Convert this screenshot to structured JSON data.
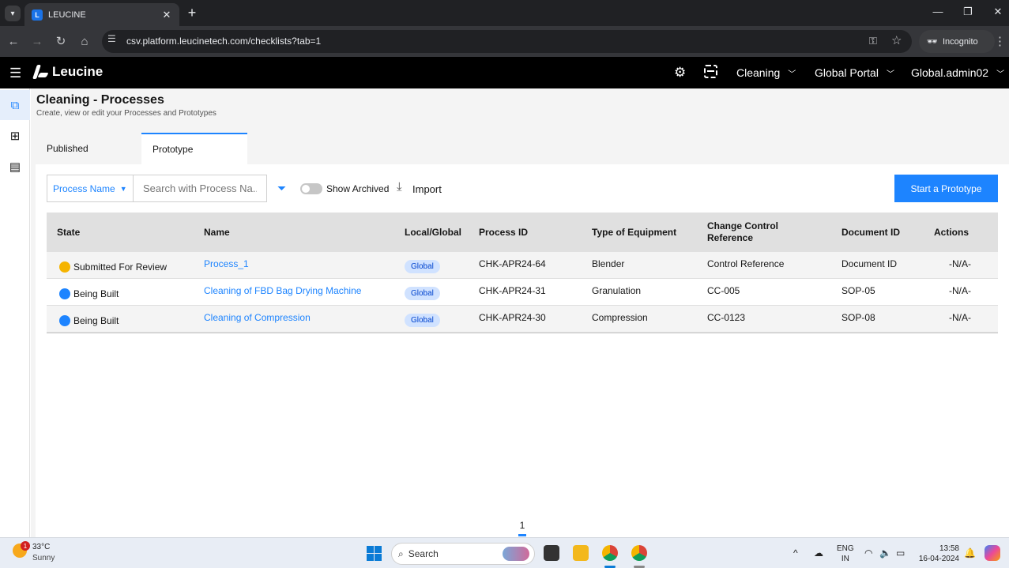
{
  "browser": {
    "tab_title": "LEUCINE",
    "url": "csv.platform.leucinetech.com/checklists?tab=1",
    "incognito_label": "Incognito"
  },
  "app": {
    "brand": "Leucine",
    "module": "Cleaning",
    "portal": "Global Portal",
    "user": "Global.admin02"
  },
  "page": {
    "title": "Cleaning - Processes",
    "subtitle": "Create, view or edit your Processes and Prototypes",
    "tabs": [
      "Published",
      "Prototype"
    ],
    "active_tab": "Prototype"
  },
  "filters": {
    "field": "Process Name",
    "search_placeholder": "Search with Process Na...",
    "show_archived": "Show Archived",
    "import": "Import",
    "primary_action": "Start a Prototype"
  },
  "table": {
    "columns": [
      "State",
      "Name",
      "Local/Global",
      "Process ID",
      "Type of Equipment",
      "Change Control Reference",
      "Document ID",
      "Actions"
    ],
    "rows": [
      {
        "state": "Submitted For Review",
        "state_color": "#f5b400",
        "name": "Process_1",
        "scope": "Global",
        "process_id": "CHK-APR24-64",
        "equipment": "Blender",
        "change_ref": "Control Reference",
        "doc_id": "Document ID",
        "actions": "-N/A-"
      },
      {
        "state": "Being Built",
        "state_color": "#1d84ff",
        "name": "Cleaning of FBD Bag Drying Machine",
        "scope": "Global",
        "process_id": "CHK-APR24-31",
        "equipment": "Granulation",
        "change_ref": "CC-005",
        "doc_id": "SOP-05",
        "actions": "-N/A-"
      },
      {
        "state": "Being Built",
        "state_color": "#1d84ff",
        "name": "Cleaning of Compression",
        "scope": "Global",
        "process_id": "CHK-APR24-30",
        "equipment": "Compression",
        "change_ref": "CC-0123",
        "doc_id": "SOP-08",
        "actions": "-N/A-"
      }
    ]
  },
  "pagination": {
    "current_page": "1"
  },
  "taskbar": {
    "temperature": "33°C",
    "condition": "Sunny",
    "weather_alerts": "1",
    "search_label": "Search",
    "lang_1": "ENG",
    "lang_2": "IN",
    "time": "13:58",
    "date": "16-04-2024"
  }
}
